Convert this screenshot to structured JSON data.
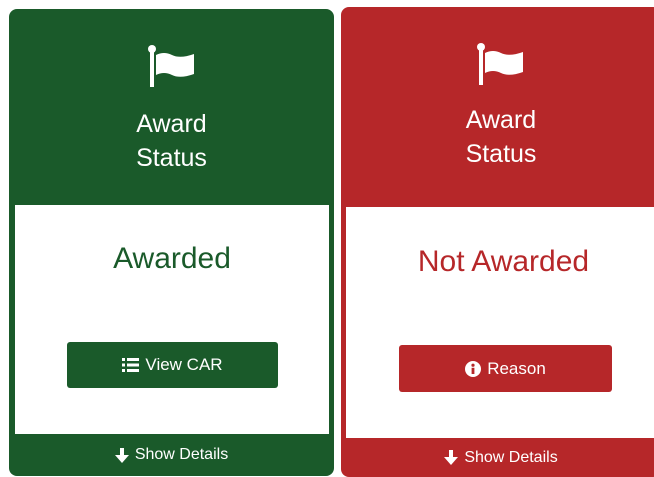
{
  "colors": {
    "success": "#1a5a2a",
    "danger": "#b62729",
    "surface": "#ffffff"
  },
  "cards": [
    {
      "icon": "flag-icon",
      "title_line1": "Award",
      "title_line2": "Status",
      "status": "Awarded",
      "button_icon": "list-icon",
      "button_label": "View CAR",
      "footer_icon": "arrow-down-icon",
      "footer_label": "Show Details"
    },
    {
      "icon": "flag-icon",
      "title_line1": "Award",
      "title_line2": "Status",
      "status": "Not Awarded",
      "button_icon": "info-circle-icon",
      "button_label": "Reason",
      "footer_icon": "arrow-down-icon",
      "footer_label": "Show Details"
    }
  ]
}
